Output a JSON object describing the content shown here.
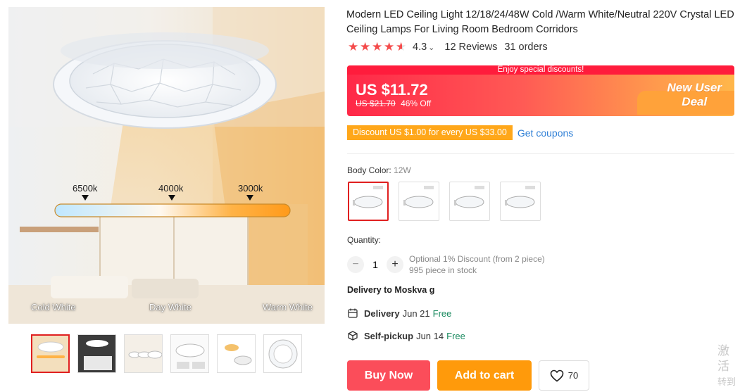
{
  "product": {
    "title": "Modern LED Ceiling Light 12/18/24/48W Cold /Warm White/Neutral 220V Crystal LED Ceiling Lamps For Living Room Bedroom Corridors",
    "rating": "4.3",
    "rating_value": 4.3,
    "reviews": "12 Reviews",
    "orders": "31 orders"
  },
  "gallery": {
    "main_image_labels": {
      "cold": "Cold White",
      "day": "Day White",
      "warm": "Warm White"
    },
    "temperatures": [
      "6500k",
      "4000k",
      "3000k"
    ],
    "thumbnail_count": 6,
    "active_thumbnail": 0
  },
  "price": {
    "banner_text": "Enjoy special discounts!",
    "current": "US $11.72",
    "original": "US $21.70",
    "discount": "46% Off",
    "deal_line1": "New User",
    "deal_line2": "Deal"
  },
  "coupon": {
    "tag": "Discount US $1.00 for every US $33.00",
    "link": "Get coupons"
  },
  "variant": {
    "label": "Body Color:",
    "selected": "12W",
    "options_count": 4,
    "active_index": 0
  },
  "quantity": {
    "label": "Quantity:",
    "value": "1",
    "minus": "−",
    "plus": "+",
    "discount_info": "Optional 1% Discount (from 2 piece)",
    "stock": "995 piece in stock"
  },
  "shipping": {
    "delivery_to": "Delivery to Moskva g",
    "delivery_label": "Delivery",
    "delivery_date": "Jun 21",
    "delivery_price": "Free",
    "pickup_label": "Self-pickup",
    "pickup_date": "Jun 14",
    "pickup_price": "Free"
  },
  "actions": {
    "buy_now": "Buy Now",
    "add_to_cart": "Add to cart",
    "wishlist_count": "70"
  },
  "watermark": {
    "line1": "激活",
    "line2": "转到"
  },
  "colors": {
    "star": "#f44b4b",
    "buy": "#fb4d5a",
    "cart": "#ff9a0b",
    "link": "#2e7fd6",
    "free": "#1a8a5f"
  }
}
